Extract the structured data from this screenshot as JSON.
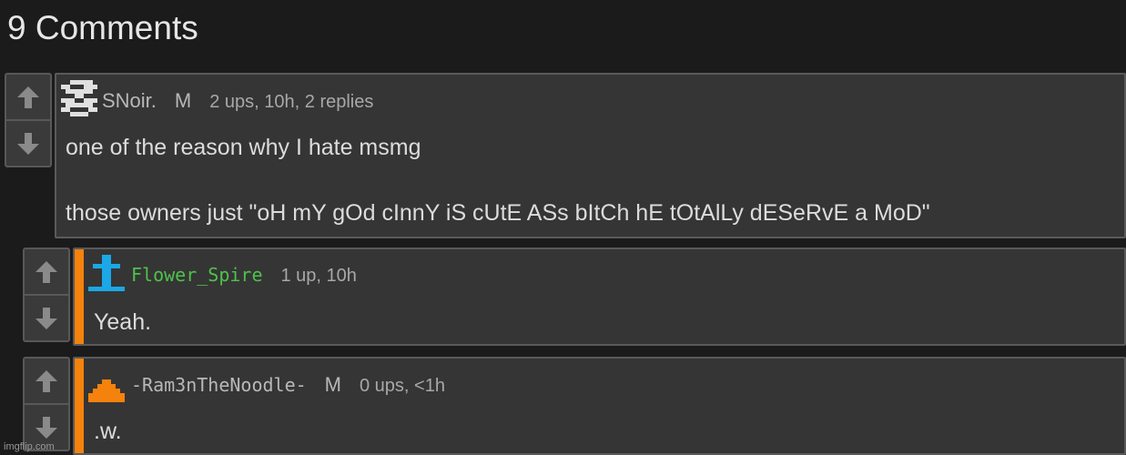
{
  "header": {
    "title": "9 Comments"
  },
  "comments": [
    {
      "username": "SNoir.",
      "mod_badge": "M",
      "stats": "2 ups, 10h, 2 replies",
      "lines": [
        "one of the reason why I hate msmg",
        "those owners just \"oH mY gOd cInnY iS cUtE ASs bItCh hE tOtAlLy dESeRvE a MoD\""
      ]
    },
    {
      "username": "Flower_Spire",
      "stats": "1 up, 10h",
      "lines": [
        "Yeah."
      ]
    },
    {
      "username": "-Ram3nTheNoodle-",
      "mod_badge": "M",
      "stats": "0 ups, <1h",
      "lines": [
        ".w."
      ]
    }
  ],
  "icons": {
    "upvote": "arrow-up-icon",
    "downvote": "arrow-down-icon",
    "avatar_1": "pixel-avatar-icon",
    "avatar_2": "pixel-cross-avatar-icon",
    "avatar_3": "pixel-pyramid-avatar-icon"
  },
  "colors": {
    "background": "#1b1b1b",
    "reply_stripe": "#f5820d",
    "username_green": "#4ec24a",
    "avatar_blue": "#1aa8e6",
    "avatar_orange": "#f5820d"
  },
  "watermark": "imgflip.com"
}
